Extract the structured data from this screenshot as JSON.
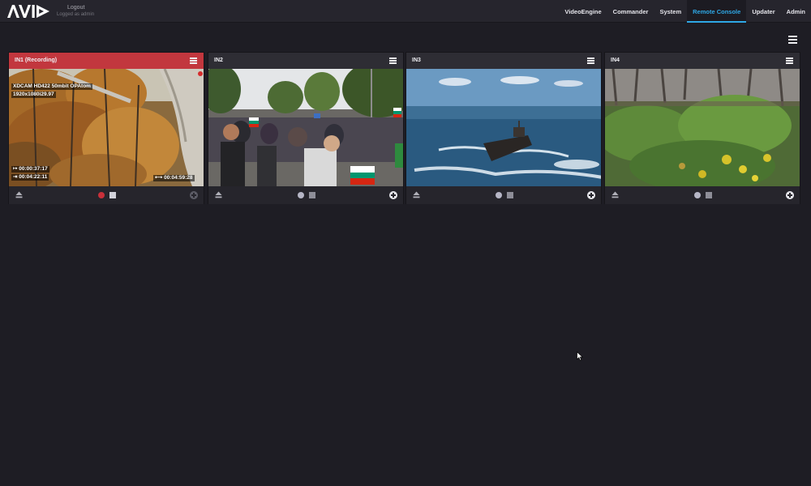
{
  "header": {
    "logo_text": "AVID",
    "logout_label": "Logout",
    "logged_in_as": "Logged as admin",
    "nav": [
      {
        "label": "VideoEngine",
        "active": false
      },
      {
        "label": "Commander",
        "active": false
      },
      {
        "label": "System",
        "active": false
      },
      {
        "label": "Remote Console",
        "active": true
      },
      {
        "label": "Updater",
        "active": false
      },
      {
        "label": "Admin",
        "active": false
      }
    ]
  },
  "colors": {
    "accent": "#2ea8e6",
    "recording_header": "#c2373e",
    "record_red": "#c8303a"
  },
  "inputs": [
    {
      "title": "IN1 (Recording)",
      "recording": true,
      "format": "XDCAM HD422 50mbit OPAtom",
      "resolution": "1920x1080i29.97",
      "timecode_in": "00:00:37:17",
      "timecode_out": "00:04:22:11",
      "duration": "00:04:59:28",
      "icons": [
        "eject-icon",
        "record-icon",
        "stop-icon",
        "add-icon"
      ]
    },
    {
      "title": "IN2",
      "recording": false,
      "icons": [
        "eject-icon",
        "record-icon",
        "stop-icon",
        "add-icon"
      ]
    },
    {
      "title": "IN3",
      "recording": false,
      "icons": [
        "eject-icon",
        "record-icon",
        "stop-icon",
        "add-icon"
      ]
    },
    {
      "title": "IN4",
      "recording": false,
      "icons": [
        "eject-icon",
        "record-icon",
        "stop-icon",
        "add-icon"
      ]
    }
  ]
}
